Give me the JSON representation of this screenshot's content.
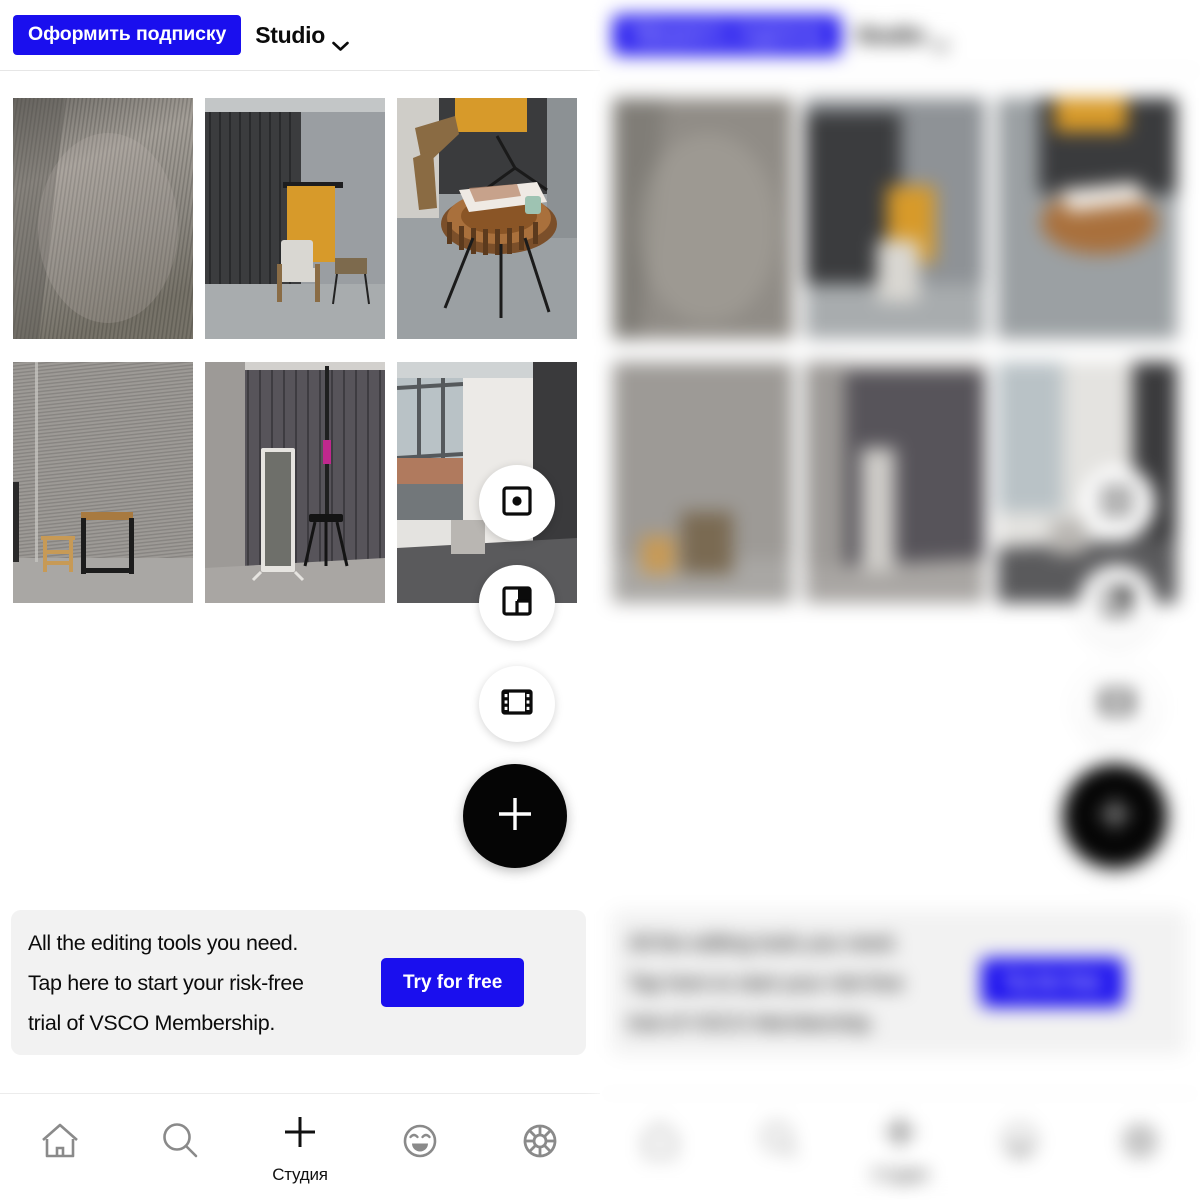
{
  "app": {
    "name": "VSCO Studio",
    "accent_blue": "#1A0FEE",
    "banner_bg": "#F2F2F2"
  },
  "header": {
    "subscribe_label": "Оформить подписку",
    "title": "Studio",
    "chevron_icon": "chevron-down-icon"
  },
  "grid": {
    "photos": [
      {
        "alt": "Textured grey concrete floor with rippled pattern"
      },
      {
        "alt": "Studio corner with dark curtain, yellow backdrop and wooden chair"
      },
      {
        "alt": "Wood slab side table with magazines and candle"
      },
      {
        "alt": "Rippled grey plaster wall with wooden stool and black side table"
      },
      {
        "alt": "Standing mirror in front of dark grey curtain with tripod stool"
      },
      {
        "alt": "Bright studio corner with window, white cyclorama and grey cube"
      }
    ]
  },
  "fabs": [
    {
      "id": "camera",
      "icon": "camera-icon",
      "label": "Camera"
    },
    {
      "id": "collage",
      "icon": "collage-icon",
      "label": "Collage"
    },
    {
      "id": "video",
      "icon": "film-icon",
      "label": "Video"
    },
    {
      "id": "add",
      "icon": "plus-icon",
      "label": "Add"
    }
  ],
  "promo": {
    "line1": "All the editing tools you need.",
    "line2": "Tap here to start your risk-free",
    "line3": "trial of VSCO Membership.",
    "cta_label": "Try for free"
  },
  "bottom_nav": {
    "items": [
      {
        "icon": "home-icon",
        "label": ""
      },
      {
        "icon": "search-icon",
        "label": ""
      },
      {
        "icon": "plus-icon",
        "label": "Студия"
      },
      {
        "icon": "smiley-icon",
        "label": ""
      },
      {
        "icon": "aperture-icon",
        "label": ""
      }
    ]
  }
}
